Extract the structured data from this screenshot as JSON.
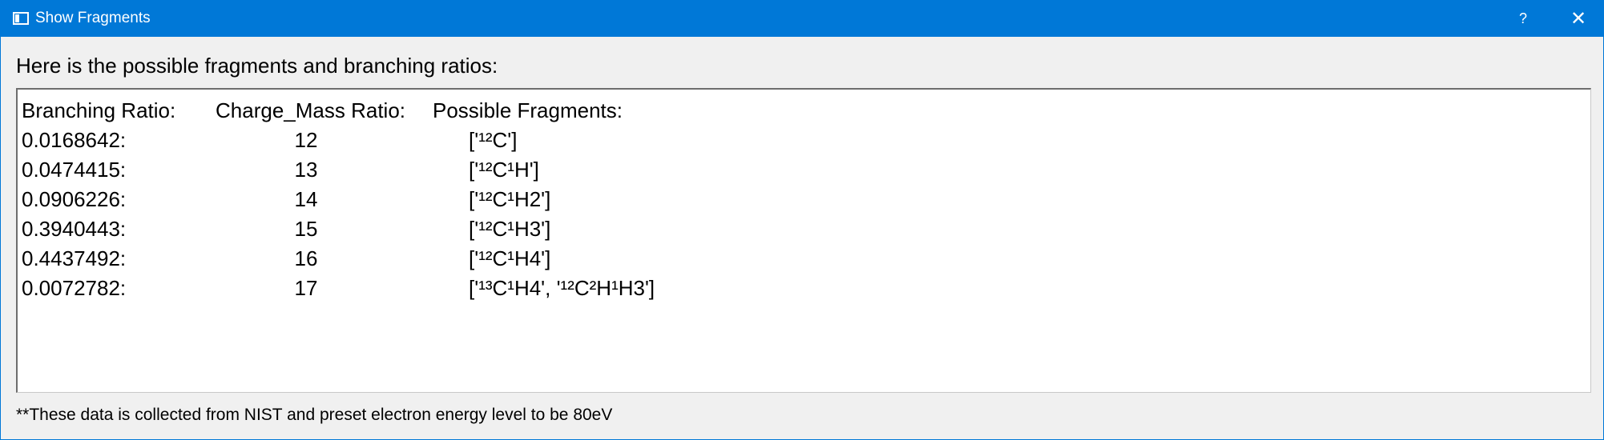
{
  "window": {
    "title": "Show Fragments",
    "help_glyph": "?",
    "close_glyph": "✕"
  },
  "header_label": "Here is the possible fragments and branching ratios:",
  "table": {
    "headers": {
      "ratio": "Branching Ratio:",
      "mass": "Charge_Mass Ratio:",
      "fragments": "Possible Fragments:"
    },
    "rows": [
      {
        "ratio": "0.0168642:",
        "mass": "12",
        "fragments": "['¹²C']"
      },
      {
        "ratio": "0.0474415:",
        "mass": "13",
        "fragments": "['¹²C¹H']"
      },
      {
        "ratio": "0.0906226:",
        "mass": "14",
        "fragments": "['¹²C¹H2']"
      },
      {
        "ratio": "0.3940443:",
        "mass": "15",
        "fragments": "['¹²C¹H3']"
      },
      {
        "ratio": "0.4437492:",
        "mass": "16",
        "fragments": "['¹²C¹H4']"
      },
      {
        "ratio": "0.0072782:",
        "mass": "17",
        "fragments": "['¹³C¹H4', '¹²C²H¹H3']"
      }
    ]
  },
  "footer_note": "**These data is collected from NIST and preset electron energy level to be 80eV",
  "colors": {
    "titlebar": "#0078d7",
    "window_bg": "#f0f0f0",
    "textbox_bg": "#ffffff"
  },
  "icons": {
    "app": "window-icon",
    "help": "help-icon",
    "close": "close-icon"
  }
}
